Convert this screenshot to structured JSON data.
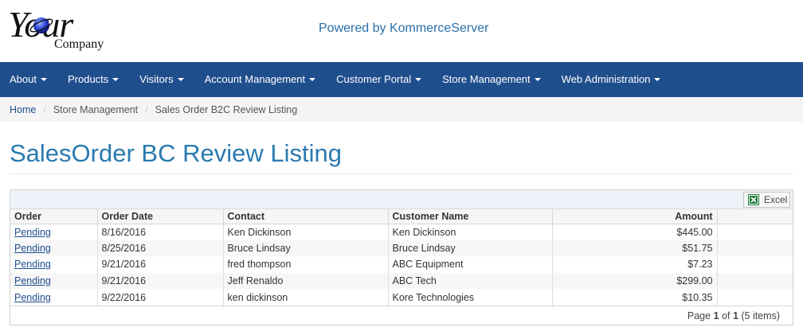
{
  "header": {
    "logo_word": "Your",
    "logo_sub": "Company",
    "powered_by": "Powered by KommerceServer"
  },
  "nav": {
    "items": [
      {
        "label": "About"
      },
      {
        "label": "Products"
      },
      {
        "label": "Visitors"
      },
      {
        "label": "Account Management"
      },
      {
        "label": "Customer Portal"
      },
      {
        "label": "Store Management"
      },
      {
        "label": "Web Administration"
      }
    ]
  },
  "breadcrumb": {
    "home": "Home",
    "section": "Store Management",
    "current": "Sales Order B2C Review Listing"
  },
  "page": {
    "title": "SalesOrder BC Review Listing"
  },
  "grid": {
    "excel_label": "Excel",
    "columns": {
      "order": "Order",
      "order_date": "Order Date",
      "contact": "Contact",
      "customer_name": "Customer Name",
      "amount": "Amount"
    },
    "rows": [
      {
        "order": "Pending",
        "order_date": "8/16/2016",
        "contact": "Ken Dickinson",
        "customer_name": "Ken Dickinson",
        "amount": "$445.00"
      },
      {
        "order": "Pending",
        "order_date": "8/25/2016",
        "contact": "Bruce Lindsay",
        "customer_name": "Bruce Lindsay",
        "amount": "$51.75"
      },
      {
        "order": "Pending",
        "order_date": "9/21/2016",
        "contact": "fred thompson",
        "customer_name": "ABC Equipment",
        "amount": "$7.23"
      },
      {
        "order": "Pending",
        "order_date": "9/21/2016",
        "contact": "Jeff Renaldo",
        "customer_name": "ABC Tech",
        "amount": "$299.00"
      },
      {
        "order": "Pending",
        "order_date": "9/22/2016",
        "contact": "ken dickinson",
        "customer_name": "Kore Technologies",
        "amount": "$10.35"
      }
    ],
    "pager": {
      "page_word": "Page",
      "current_page": "1",
      "of_word": "of",
      "total_pages": "1",
      "items_text": "(5 items)"
    }
  },
  "colors": {
    "navbar": "#1f4e8c",
    "title": "#2a7ab0",
    "link": "#1f4e8c",
    "excel_green": "#1d7a3a"
  },
  "icons": {
    "logo_globe": "globe-logo-icon",
    "excel": "excel-icon",
    "dropdown": "caret-down-icon"
  }
}
